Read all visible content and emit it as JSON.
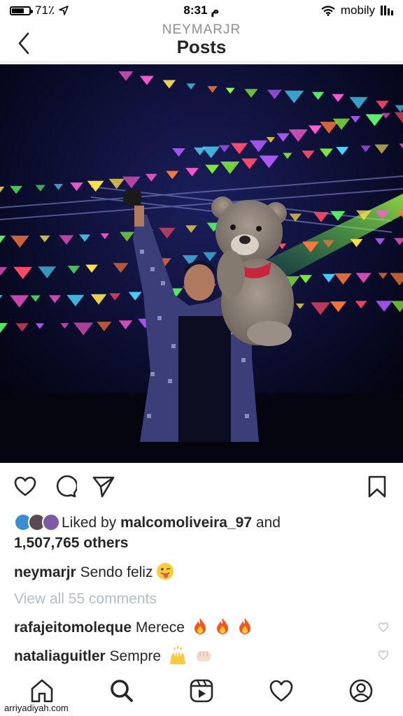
{
  "status_bar": {
    "battery": "71٪",
    "battery_level": 0.71,
    "time": "م 8:31",
    "carrier": "mobily"
  },
  "header": {
    "username": "NEYMARJR",
    "title": "Posts"
  },
  "post": {
    "liked_by_prefix": "Liked by",
    "liked_by_user": "malcomoliveira_97",
    "liked_by_and": "and",
    "likes_count": "1,507,765 others",
    "caption_user": "neymarjr",
    "caption_text": "Sendo feliz",
    "view_comments": "View all 55 comments",
    "comments": [
      {
        "user": "rafajeitomoleque",
        "text": "Merece"
      },
      {
        "user": "nataliaguitler",
        "text": "Sempre"
      }
    ]
  },
  "icons": {
    "actions": [
      "heart-icon",
      "comment-icon",
      "share-icon",
      "bookmark-icon"
    ],
    "tabs": [
      "home-icon",
      "search-icon",
      "reels-icon",
      "activity-icon",
      "profile-icon"
    ]
  },
  "colors": {
    "text": "#262626",
    "muted": "#8e8e8e",
    "link_muted": "#b5bdc4",
    "border": "#dbdbdb"
  },
  "watermark": "arriyadiyah.com"
}
